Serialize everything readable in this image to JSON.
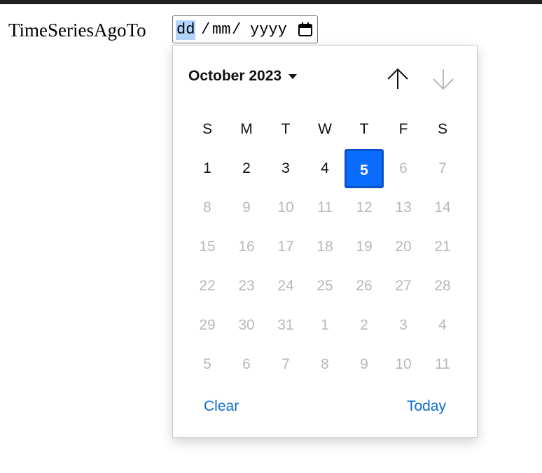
{
  "label": "TimeSeriesAgoTo",
  "date_input": {
    "day_placeholder": "dd",
    "separator": "/",
    "month_placeholder": "mm",
    "year_placeholder": "yyyy"
  },
  "picker": {
    "month_label": "October 2023",
    "weekdays": [
      "S",
      "M",
      "T",
      "W",
      "T",
      "F",
      "S"
    ],
    "weeks": [
      [
        "1",
        "2",
        "3",
        "4",
        "5",
        "6",
        "7"
      ],
      [
        "8",
        "9",
        "10",
        "11",
        "12",
        "13",
        "14"
      ],
      [
        "15",
        "16",
        "17",
        "18",
        "19",
        "20",
        "21"
      ],
      [
        "22",
        "23",
        "24",
        "25",
        "26",
        "27",
        "28"
      ],
      [
        "29",
        "30",
        "31",
        "1",
        "2",
        "3",
        "4"
      ],
      [
        "5",
        "6",
        "7",
        "8",
        "9",
        "10",
        "11"
      ]
    ],
    "selected_day": "5",
    "enabled_days": [
      "1",
      "2",
      "3",
      "4",
      "5"
    ],
    "clear_label": "Clear",
    "today_label": "Today"
  },
  "colors": {
    "accent": "#0a6cff",
    "link": "#0a6ccf",
    "disabled_text": "#b8b8b8"
  }
}
